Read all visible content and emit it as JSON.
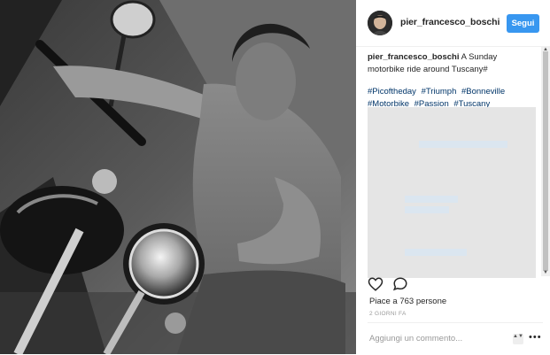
{
  "post": {
    "username": "pier_francesco_boschi",
    "follow_label": "Segui",
    "caption_author": "pier_francesco_boschi",
    "caption_text": "A Sunday motorbike ride around Tuscany#",
    "hashtags": [
      "#Picoftheday",
      "#Triumph",
      "#Bonneville",
      "#Motorbike",
      "#Passion",
      "#Tuscany"
    ],
    "likes": "Piace a 763 persone",
    "time": "2 GIORNI FA",
    "comment_placeholder": "Aggiungi un commento...",
    "more_label": "•••",
    "updown_label": "▲▼"
  },
  "icons": {
    "like": "heart-icon",
    "comment": "comment-icon",
    "more": "more-options-icon"
  },
  "colors": {
    "follow_button": "#3897f0",
    "hashtag": "#003569",
    "overlay": "#e5e5e5"
  }
}
